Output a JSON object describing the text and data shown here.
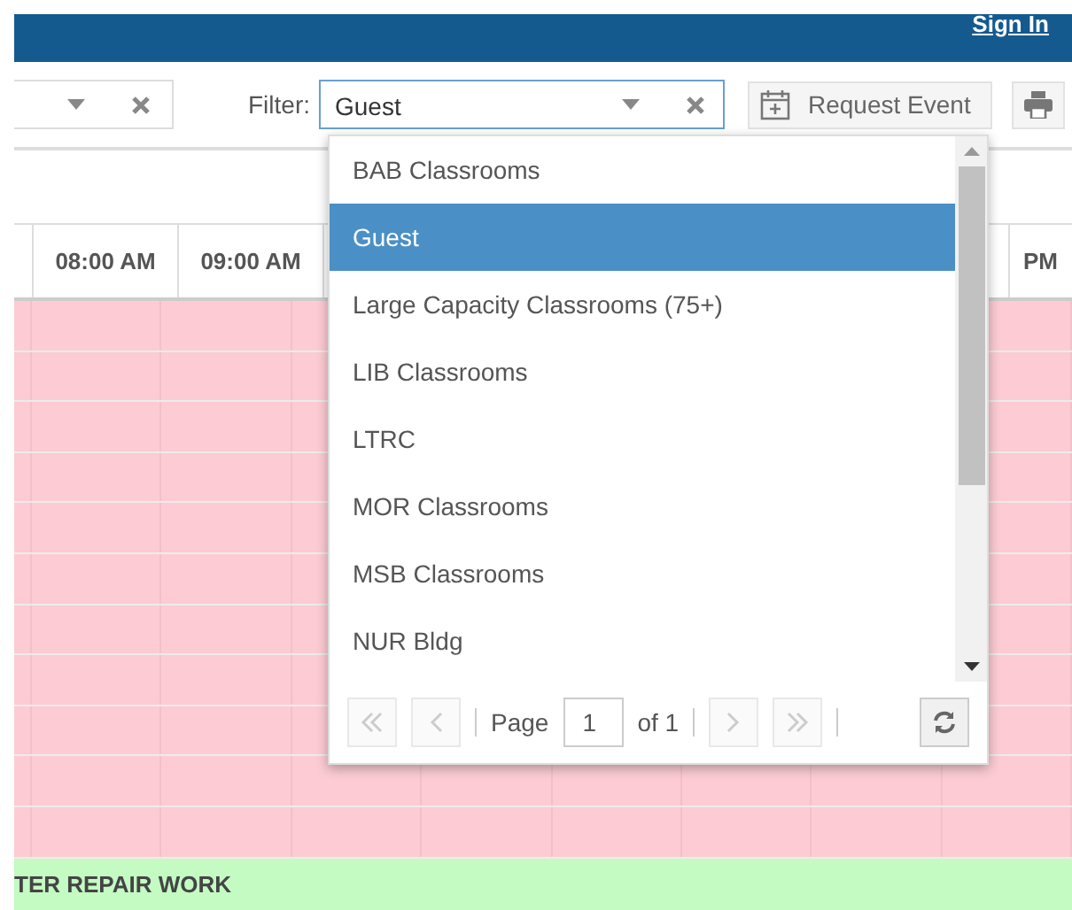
{
  "header": {
    "sign_in": "Sign In"
  },
  "toolbar": {
    "filter_label": "Filter:",
    "filter_value": "Guest",
    "request_button": "Request Event"
  },
  "grid": {
    "columns": [
      "08:00 AM",
      "09:00 AM",
      "PM"
    ],
    "event": "TER REPAIR WORK"
  },
  "dropdown": {
    "items": [
      {
        "label": "BAB Classrooms",
        "selected": false
      },
      {
        "label": "Guest",
        "selected": true
      },
      {
        "label": "Large Capacity Classrooms (75+)",
        "selected": false
      },
      {
        "label": "LIB Classrooms",
        "selected": false
      },
      {
        "label": "LTRC",
        "selected": false
      },
      {
        "label": "MOR Classrooms",
        "selected": false
      },
      {
        "label": "MSB Classrooms",
        "selected": false
      },
      {
        "label": "NUR Bldg",
        "selected": false
      }
    ],
    "pager": {
      "page_label": "Page",
      "page": "1",
      "of_label": "of 1"
    }
  }
}
